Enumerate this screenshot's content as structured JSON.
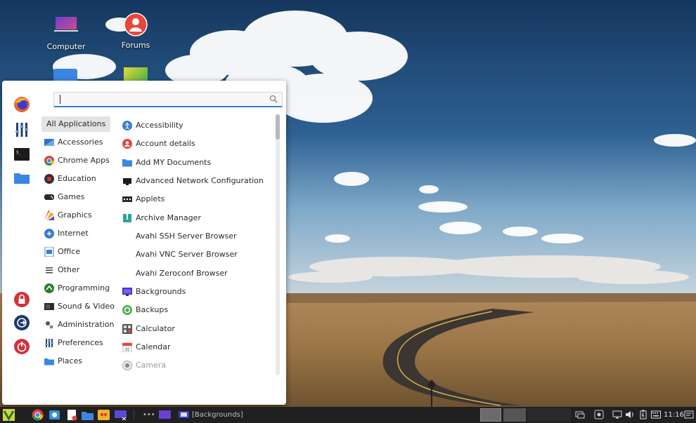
{
  "desktop": {
    "icons": [
      {
        "label": "Computer"
      },
      {
        "label": "Forums"
      }
    ]
  },
  "menu": {
    "search": {
      "value": "",
      "placeholder": ""
    },
    "favorites": [
      "firefox-icon",
      "settings-sliders-icon",
      "terminal-icon",
      "folder-icon"
    ],
    "session": [
      "lock-icon",
      "logout-icon",
      "power-icon"
    ],
    "categories": [
      {
        "label": "All Applications",
        "icon": "none",
        "selected": true
      },
      {
        "label": "Accessories",
        "icon": "accessories-icon"
      },
      {
        "label": "Chrome Apps",
        "icon": "chrome-icon"
      },
      {
        "label": "Education",
        "icon": "education-icon"
      },
      {
        "label": "Games",
        "icon": "gamepad-icon"
      },
      {
        "label": "Graphics",
        "icon": "graphics-icon"
      },
      {
        "label": "Internet",
        "icon": "internet-icon"
      },
      {
        "label": "Office",
        "icon": "office-icon"
      },
      {
        "label": "Other",
        "icon": "other-icon"
      },
      {
        "label": "Programming",
        "icon": "programming-icon"
      },
      {
        "label": "Sound & Video",
        "icon": "sound-video-icon"
      },
      {
        "label": "Administration",
        "icon": "administration-icon"
      },
      {
        "label": "Preferences",
        "icon": "preferences-icon"
      },
      {
        "label": "Places",
        "icon": "places-folder-icon"
      }
    ],
    "apps": [
      {
        "label": "Accessibility",
        "icon": "accessibility-icon"
      },
      {
        "label": "Account details",
        "icon": "account-icon"
      },
      {
        "label": "Add MY Documents",
        "icon": "folder-icon"
      },
      {
        "label": "Advanced Network Configuration",
        "icon": "network-icon"
      },
      {
        "label": "Applets",
        "icon": "applets-icon"
      },
      {
        "label": "Archive Manager",
        "icon": "archive-icon"
      },
      {
        "label": "Avahi SSH Server Browser",
        "icon": "none"
      },
      {
        "label": "Avahi VNC Server Browser",
        "icon": "none"
      },
      {
        "label": "Avahi Zeroconf Browser",
        "icon": "none"
      },
      {
        "label": "Backgrounds",
        "icon": "backgrounds-icon"
      },
      {
        "label": "Backups",
        "icon": "backups-icon"
      },
      {
        "label": "Calculator",
        "icon": "calculator-icon"
      },
      {
        "label": "Calendar",
        "icon": "calendar-icon"
      },
      {
        "label": "Camera",
        "icon": "camera-icon",
        "dimmed": true
      }
    ]
  },
  "taskbar": {
    "window_title": "[Backgrounds]",
    "clock": "11:16",
    "colors": {
      "panel": "#202020",
      "accent": "#3c7cd1"
    }
  }
}
